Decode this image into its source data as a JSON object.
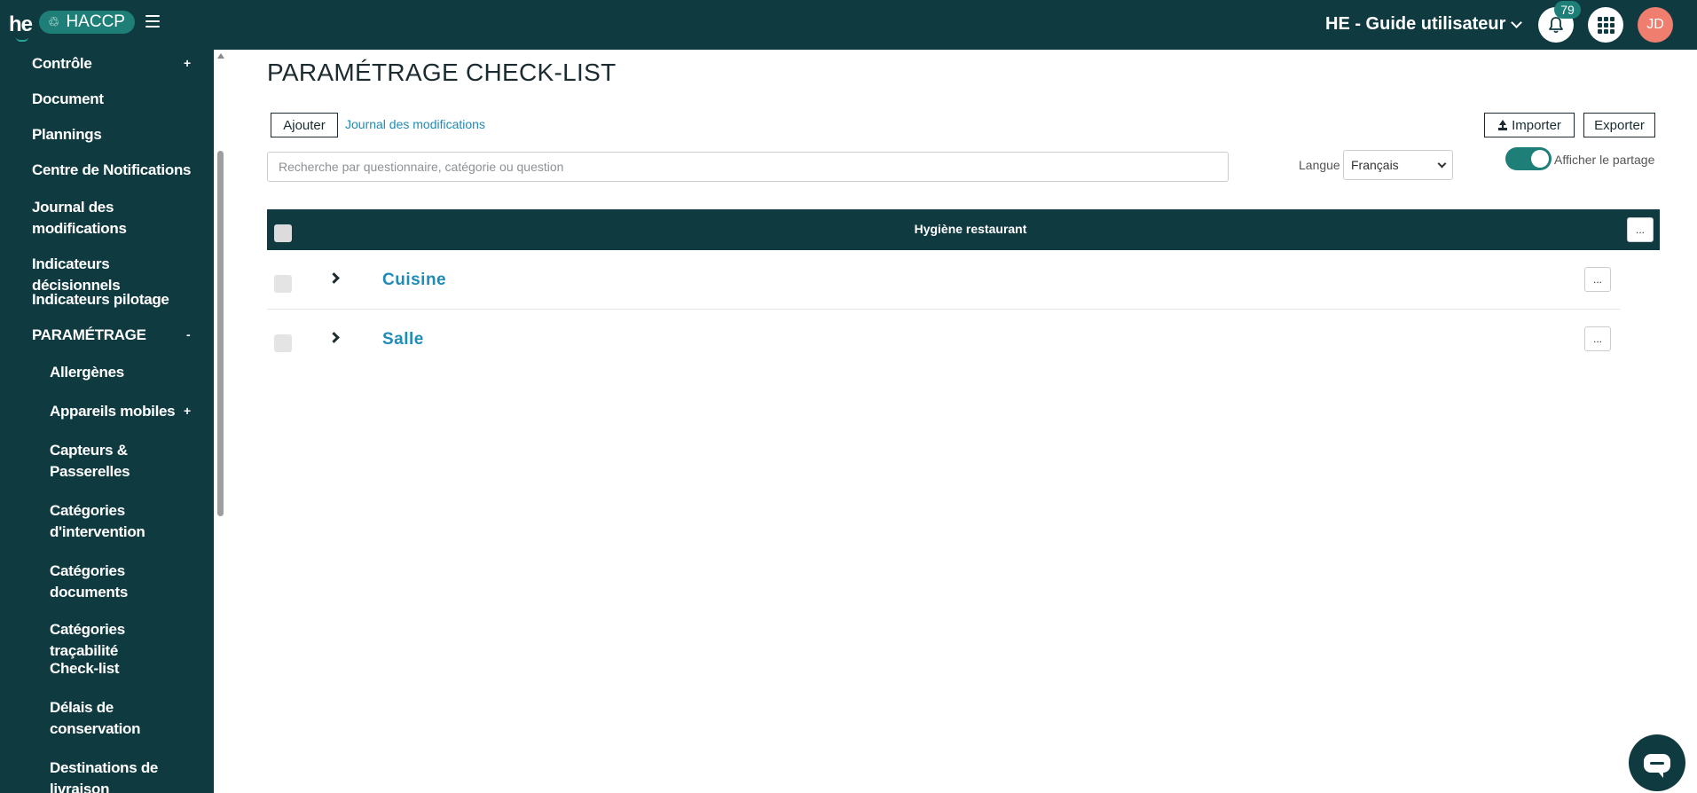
{
  "topbar": {
    "logo": "he",
    "app_name": "HACCP",
    "app_icon": "recycle-icon",
    "site": "HE - Guide utilisateur",
    "notification_count": "79",
    "avatar_initials": "JD"
  },
  "sidebar": {
    "items": [
      {
        "label": "Contrôle",
        "toggle": "+"
      },
      {
        "label": "Document"
      },
      {
        "label": "Plannings"
      },
      {
        "label": "Centre de Notifications"
      },
      {
        "label": "Journal des modifications"
      },
      {
        "label": "Indicateurs décisionnels"
      },
      {
        "label": "Indicateurs pilotage"
      },
      {
        "label": "PARAMÉTRAGE",
        "toggle": "-"
      }
    ],
    "subitems": [
      {
        "label": "Allergènes"
      },
      {
        "label": "Appareils mobiles",
        "toggle": "+"
      },
      {
        "label": "Capteurs & Passerelles"
      },
      {
        "label": "Catégories d'intervention"
      },
      {
        "label": "Catégories documents"
      },
      {
        "label": "Catégories traçabilité"
      },
      {
        "label": "Check-list"
      },
      {
        "label": "Délais de conservation"
      },
      {
        "label": "Destinations de livraison"
      }
    ]
  },
  "main": {
    "title": "PARAMÉTRAGE CHECK-LIST",
    "add_label": "Ajouter",
    "journal_link": "Journal des modifications",
    "import_label": "Importer",
    "export_label": "Exporter",
    "search_placeholder": "Recherche par questionnaire, catégorie ou question",
    "language_label": "Langue",
    "language_value": "Français",
    "share_toggle_label": "Afficher le partage",
    "share_toggle_on": true
  },
  "table": {
    "header": "Hygiène restaurant",
    "more": "...",
    "rows": [
      {
        "title": "Cuisine",
        "more": "..."
      },
      {
        "title": "Salle",
        "more": "..."
      }
    ]
  },
  "colors": {
    "primary_dark": "#0f3a40",
    "accent_teal": "#1e7f78",
    "link_blue": "#1f8bb8",
    "avatar": "#f07e6e"
  }
}
